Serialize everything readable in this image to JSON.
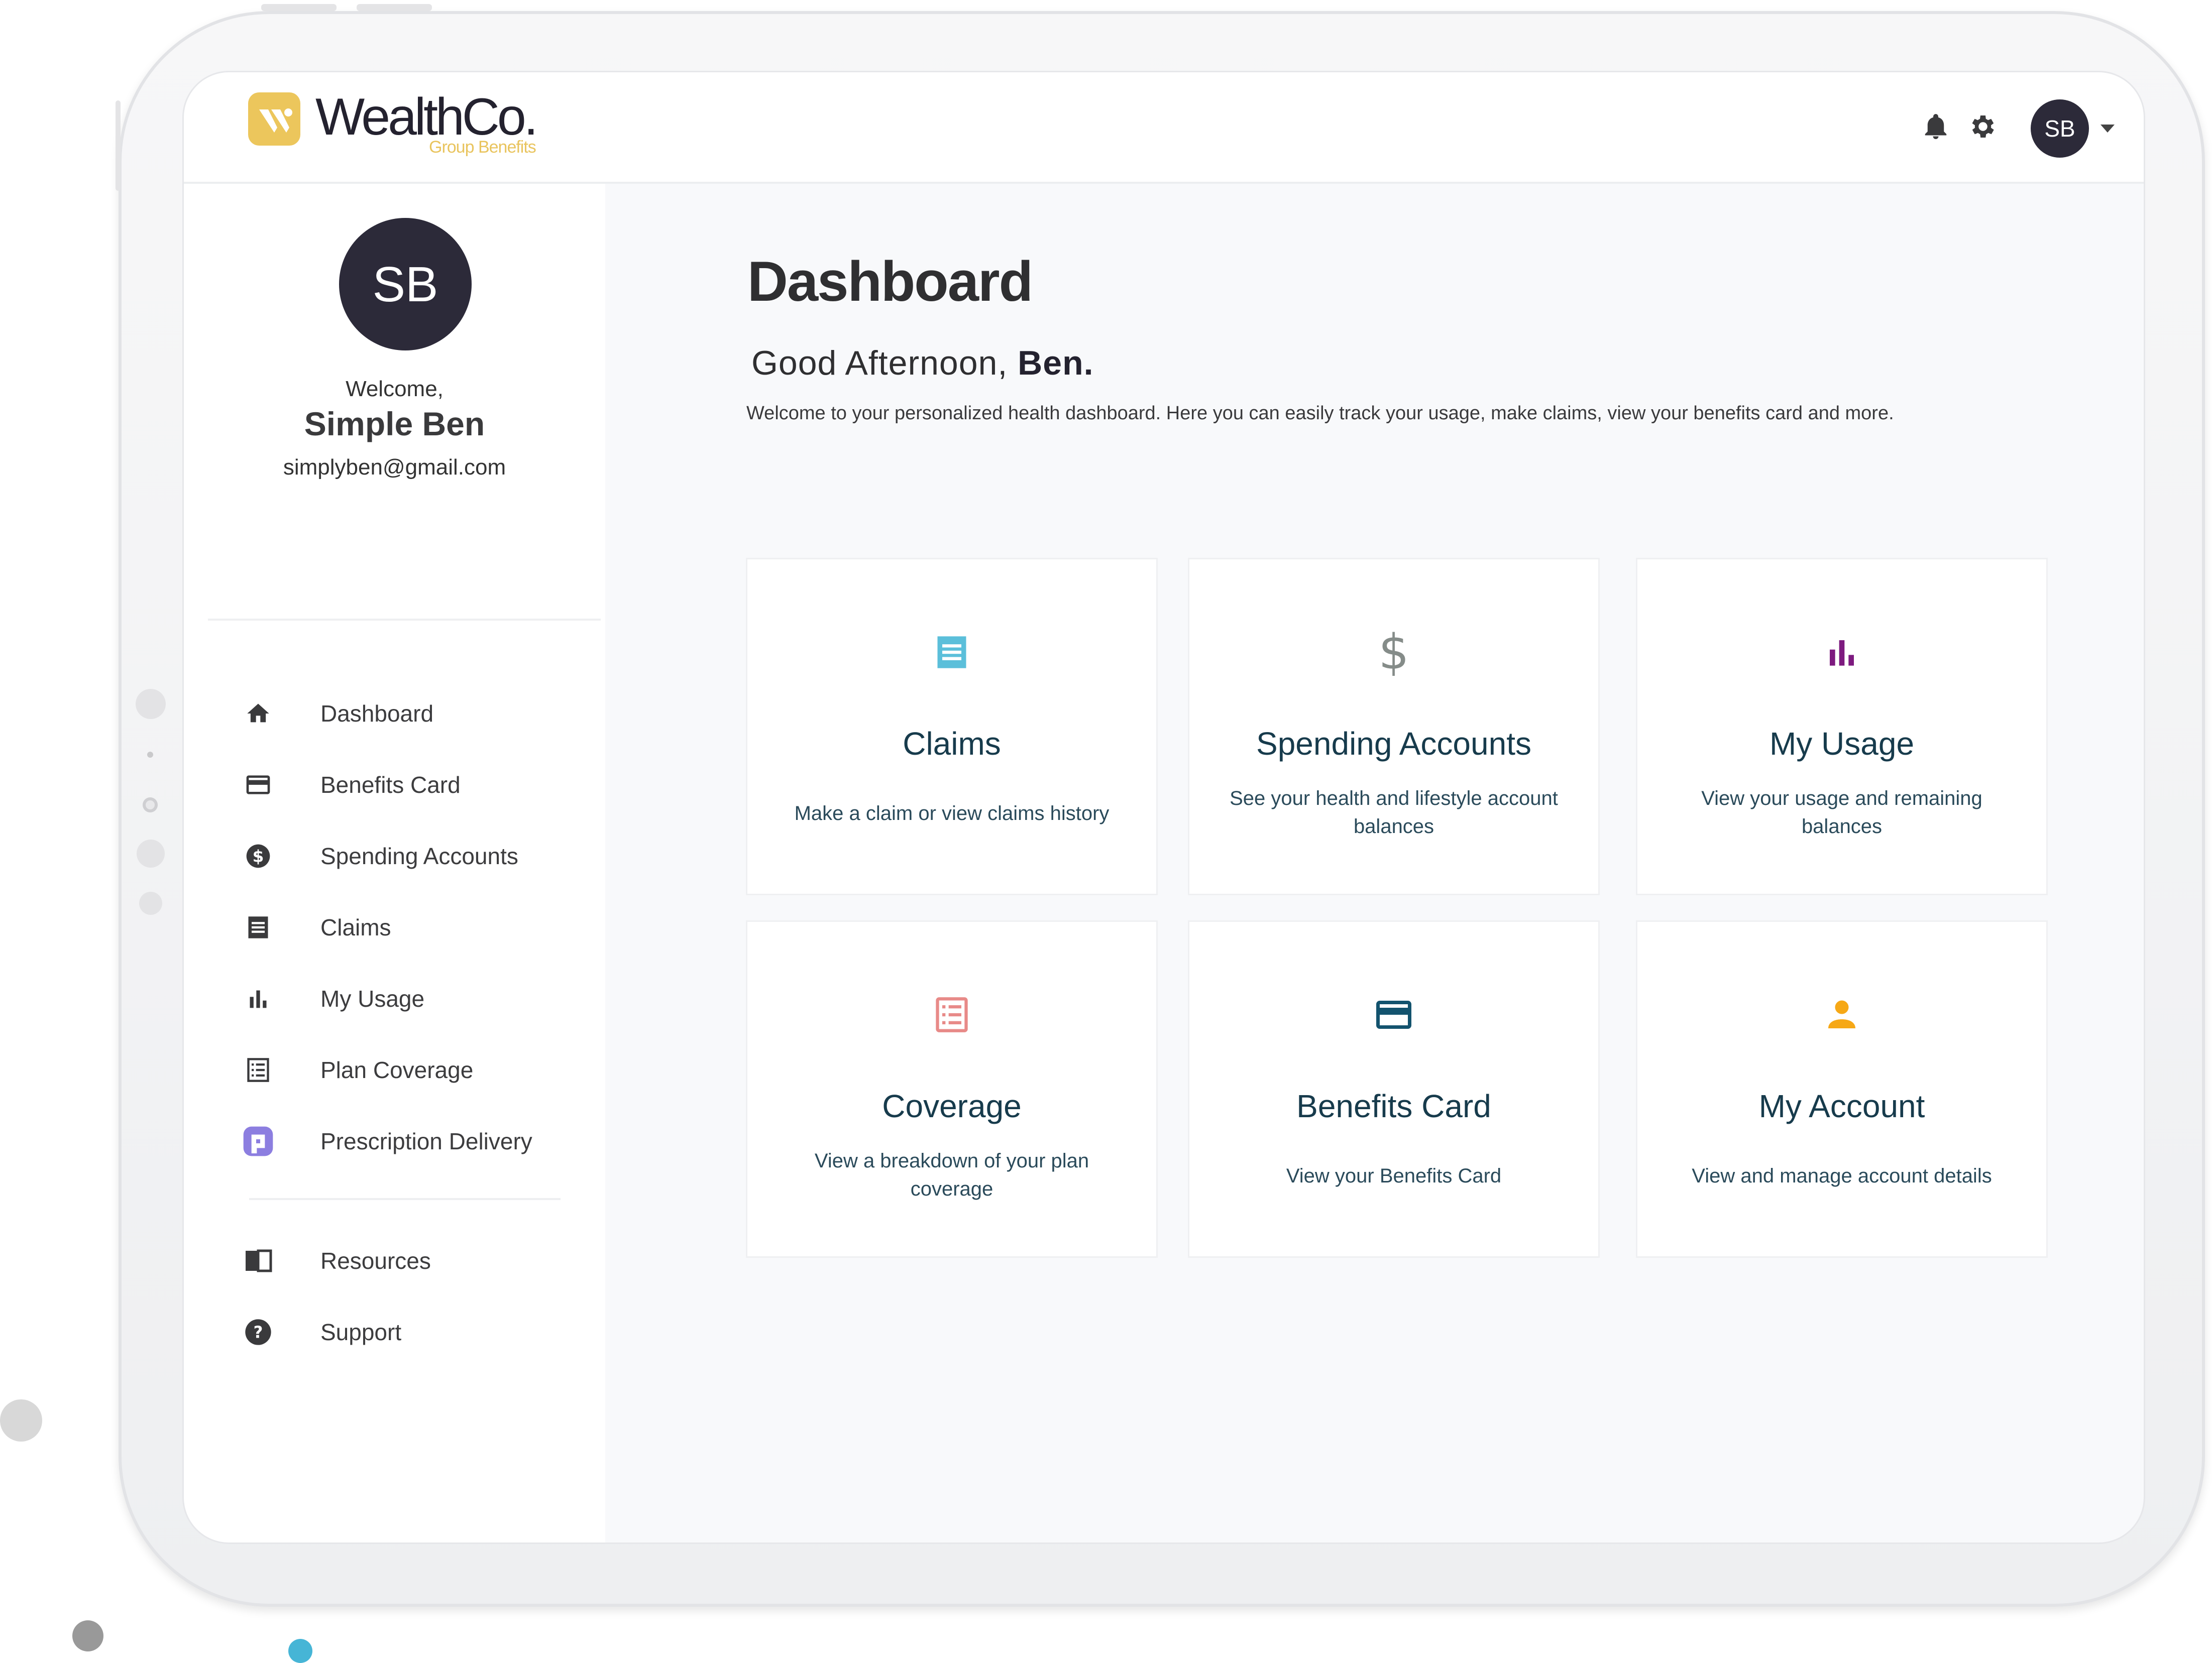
{
  "app": {
    "brand_name": "WealthCo.",
    "brand_sub": "Group Benefits",
    "accent_color": "#ecc65c"
  },
  "header": {
    "notification_icon": "bell-icon",
    "settings_icon": "gear-icon",
    "avatar_initials": "SB",
    "dropdown_icon": "caret-down-icon"
  },
  "profile": {
    "initials": "SB",
    "welcome": "Welcome,",
    "name": "Simple Ben",
    "email": "simplyben@gmail.com"
  },
  "sidebar": {
    "items": [
      {
        "label": "Dashboard",
        "icon": "home-icon"
      },
      {
        "label": "Benefits Card",
        "icon": "credit-card-icon"
      },
      {
        "label": "Spending Accounts",
        "icon": "dollar-circle-icon"
      },
      {
        "label": "Claims",
        "icon": "receipt-icon"
      },
      {
        "label": "My Usage",
        "icon": "bar-chart-icon"
      },
      {
        "label": "Plan Coverage",
        "icon": "list-alt-icon"
      },
      {
        "label": "Prescription Delivery",
        "icon": "pharmacy-p-icon"
      }
    ],
    "secondary_items": [
      {
        "label": "Resources",
        "icon": "book-icon"
      },
      {
        "label": "Support",
        "icon": "help-circle-icon"
      }
    ]
  },
  "main": {
    "title": "Dashboard",
    "greeting_prefix": "Good Afternoon, ",
    "greeting_name": "Ben.",
    "intro": "Welcome to your personalized health dashboard. Here you can easily track your usage, make claims, view your benefits card and more.",
    "cards": [
      {
        "title": "Claims",
        "description": "Make a claim or view claims history",
        "icon": "receipt-icon",
        "color": "#5bbfda"
      },
      {
        "title": "Spending Accounts",
        "description": "See your health and lifestyle account balances",
        "icon": "dollar-icon",
        "color": "#858c89"
      },
      {
        "title": "My Usage",
        "description": "View your usage and remaining balances",
        "icon": "bar-chart-icon",
        "color": "#7d1a7f"
      },
      {
        "title": "Coverage",
        "description": "View a breakdown of your plan coverage",
        "icon": "list-alt-icon",
        "color": "#e88a88"
      },
      {
        "title": "Benefits Card",
        "description": "View your Benefits Card",
        "icon": "credit-card-icon",
        "color": "#13536e"
      },
      {
        "title": "My Account",
        "description": "View and manage account details",
        "icon": "person-icon",
        "color": "#f6a816"
      }
    ]
  }
}
